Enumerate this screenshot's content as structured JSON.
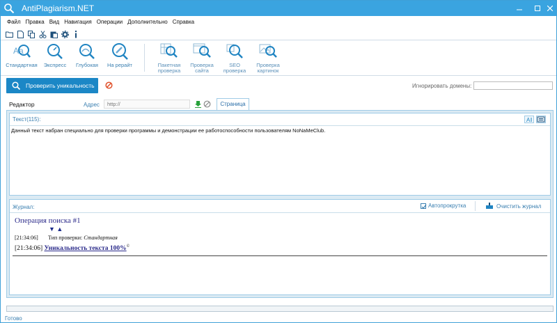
{
  "window": {
    "title": "AntiPlagiarism.NET"
  },
  "menu": [
    "Файл",
    "Правка",
    "Вид",
    "Навигация",
    "Операции",
    "Дополнительно",
    "Справка"
  ],
  "quick_toolbar": [
    "open-folder-icon",
    "new-doc-icon",
    "copy-icon",
    "cut-icon",
    "paste-icon",
    "settings-icon",
    "info-icon"
  ],
  "ribbon": {
    "items": [
      {
        "label": "Стандартная"
      },
      {
        "label": "Экспресс"
      },
      {
        "label": "Глубокая"
      },
      {
        "label": "На рерайт"
      },
      {
        "label_line1": "Пакетная",
        "label_line2": "проверка"
      },
      {
        "label_line1": "Проверка",
        "label_line2": "сайта"
      },
      {
        "label_line1": "SEO",
        "label_line2": "проверка"
      },
      {
        "label_line1": "Проверка",
        "label_line2": "картинок"
      }
    ]
  },
  "actions": {
    "check_label": "Проверить уникальность",
    "ignore_domains_label": "Игнорировать домены:",
    "ignore_domains_value": ""
  },
  "editor": {
    "tab_label": "Редактор",
    "address_label": "Адрес",
    "address_placeholder": "http://",
    "page_tab_label": "Страница",
    "text_header": "Текст(115):",
    "text_content": "Данный текст набран специально для проверки программы и демонстрации ее работоспособности пользователям NoNaMeClub."
  },
  "journal": {
    "header": "Журнал:",
    "autoscroll_label": "Автопрокрутка",
    "autoscroll_checked": true,
    "clear_label": "Очистить журнал",
    "operation_title": "Операция поиска #1",
    "arrows": "▼  ▲",
    "log1_time": "[21:34:06]",
    "log1_prefix": "Тип проверки:",
    "log1_value": "Стандартная",
    "log2_time": "[21:34:06]",
    "log2_result": "Уникальность текста 100%",
    "log2_mark": "©"
  },
  "status": {
    "text": "Готово"
  },
  "colors": {
    "titlebar": "#3aa4e0",
    "accent": "#1b87c6",
    "link": "#2a2a8a"
  }
}
